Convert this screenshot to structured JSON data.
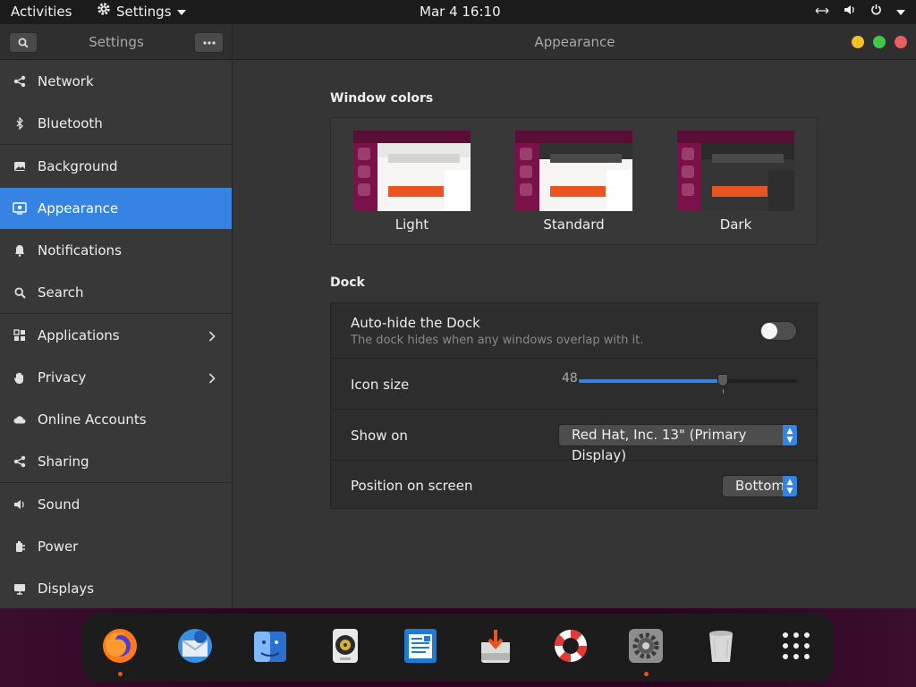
{
  "topbar": {
    "activities": "Activities",
    "app_menu": "Settings",
    "clock": "Mar 4  16:10"
  },
  "window": {
    "sidebar_title": "Settings",
    "page_title": "Appearance"
  },
  "sidebar": {
    "items": [
      {
        "label": "Network",
        "icon": "network-icon"
      },
      {
        "label": "Bluetooth",
        "icon": "bluetooth-icon"
      },
      {
        "label": "Background",
        "icon": "background-icon"
      },
      {
        "label": "Appearance",
        "icon": "appearance-icon",
        "selected": true
      },
      {
        "label": "Notifications",
        "icon": "bell-icon"
      },
      {
        "label": "Search",
        "icon": "search-icon"
      },
      {
        "label": "Applications",
        "icon": "applications-icon",
        "has_submenu": true
      },
      {
        "label": "Privacy",
        "icon": "privacy-hand-icon",
        "has_submenu": true
      },
      {
        "label": "Online Accounts",
        "icon": "cloud-icon"
      },
      {
        "label": "Sharing",
        "icon": "share-icon"
      },
      {
        "label": "Sound",
        "icon": "speaker-icon"
      },
      {
        "label": "Power",
        "icon": "power-plug-icon"
      },
      {
        "label": "Displays",
        "icon": "display-icon"
      }
    ]
  },
  "window_colors": {
    "title": "Window colors",
    "options": [
      {
        "label": "Light"
      },
      {
        "label": "Standard"
      },
      {
        "label": "Dark"
      }
    ]
  },
  "dock": {
    "title": "Dock",
    "autohide": {
      "title": "Auto-hide the Dock",
      "subtitle": "The dock hides when any windows overlap with it.",
      "enabled": false
    },
    "icon_size": {
      "label": "Icon size",
      "value": "48",
      "fraction": 0.66
    },
    "show_on": {
      "label": "Show on",
      "value": "Red Hat, Inc. 13\" (Primary Display)"
    },
    "position": {
      "label": "Position on screen",
      "value": "Bottom"
    }
  },
  "dock_apps": [
    {
      "name": "firefox-icon",
      "running": true
    },
    {
      "name": "thunderbird-icon",
      "running": false
    },
    {
      "name": "files-icon",
      "running": false
    },
    {
      "name": "rhythmbox-icon",
      "running": false
    },
    {
      "name": "writer-icon",
      "running": false
    },
    {
      "name": "software-install-icon",
      "running": false
    },
    {
      "name": "help-lifebuoy-icon",
      "running": false
    },
    {
      "name": "settings-icon",
      "running": true
    },
    {
      "name": "trash-icon",
      "running": false
    },
    {
      "name": "show-apps-grid-icon",
      "running": false
    }
  ],
  "colors": {
    "accent": "#3584e4",
    "ubuntu_orange": "#e95420",
    "aubergine": "#2c001e"
  }
}
